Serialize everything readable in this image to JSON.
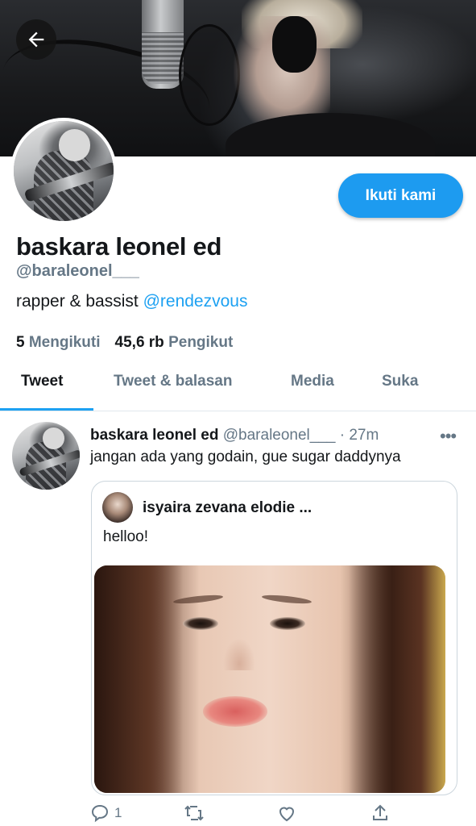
{
  "profile": {
    "name": "baskara leonel ed",
    "handle": "@baraleonel___",
    "bio_text": "rapper & bassist ",
    "bio_mention": "@rendezvous",
    "following_count": "5",
    "following_label": "Mengikuti",
    "followers_count": "45,6 rb",
    "followers_label": "Pengikut",
    "follow_button": "Ikuti kami"
  },
  "tabs": [
    {
      "label": "Tweet",
      "active": true
    },
    {
      "label": "Tweet & balasan",
      "active": false
    },
    {
      "label": "Media",
      "active": false
    },
    {
      "label": "Suka",
      "active": false
    }
  ],
  "tweet": {
    "name": "baskara leonel ed",
    "meta": "@baraleonel___ · 27m",
    "text": "jangan ada yang godain, gue sugar daddynya",
    "quote": {
      "name": "isyaira zevana elodie ...",
      "text": "helloo!"
    },
    "actions": {
      "reply_count": "1",
      "retweet_count": "",
      "like_count": ""
    }
  },
  "colors": {
    "accent": "#1da1f2",
    "button": "#1d9bf0",
    "secondary_text": "#657786"
  }
}
